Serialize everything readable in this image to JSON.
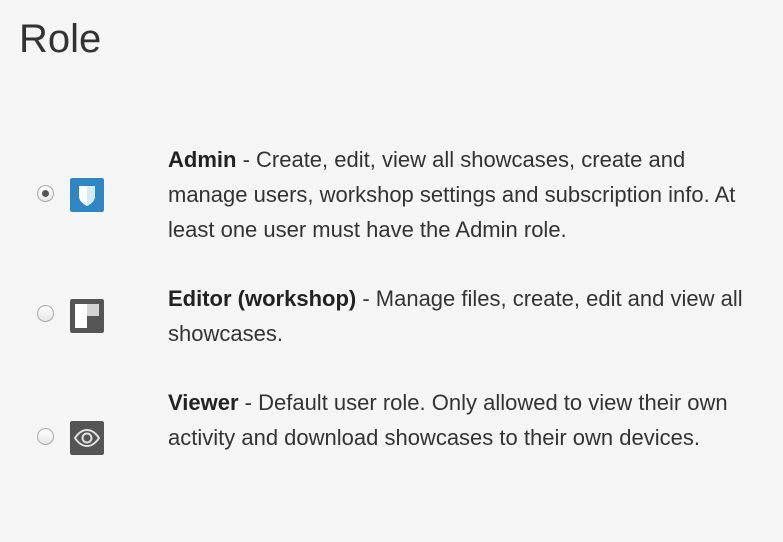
{
  "page": {
    "title": "Role"
  },
  "roles": [
    {
      "name": "Admin",
      "description": " - Create, edit, view all showcases, create and manage users, workshop settings and subscription info. At least one user must have the Admin role.",
      "selected": true,
      "icon": "shield-icon",
      "icon_color": "#2f86c5"
    },
    {
      "name": "Editor (workshop)",
      "description": " - Manage files, create, edit and view all showcases.",
      "selected": false,
      "icon": "grid-squares-icon",
      "icon_color": "#555555"
    },
    {
      "name": "Viewer",
      "description": " - Default user role. Only allowed to view their own activity and download showcases to their own devices.",
      "selected": false,
      "icon": "eye-icon",
      "icon_color": "#555555"
    }
  ]
}
